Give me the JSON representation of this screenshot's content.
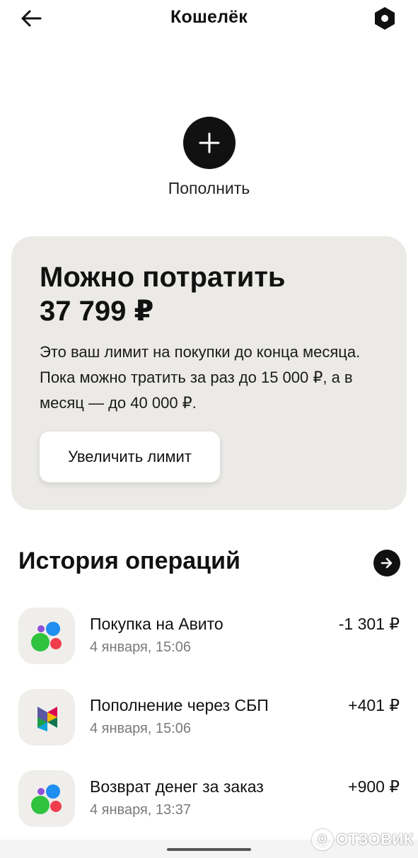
{
  "header": {
    "title": "Кошелёк"
  },
  "topup": {
    "label": "Пополнить"
  },
  "limit_card": {
    "title": "Можно потратить",
    "amount": "37 799 ₽",
    "description": "Это ваш лимит на покупки до конца месяца. Пока можно тратить за раз до 15 000 ₽, а в месяц — до 40 000 ₽.",
    "button_label": "Увеличить лимит"
  },
  "history": {
    "title": "История операций",
    "items": [
      {
        "name": "Покупка на Авито",
        "date": "4 января, 15:06",
        "amount": "-1 301 ₽",
        "icon": "avito-logo-icon"
      },
      {
        "name": "Пополнение через СБП",
        "date": "4 января, 15:06",
        "amount": "+401 ₽",
        "icon": "sbp-logo-icon"
      },
      {
        "name": "Возврат денег за заказ",
        "date": "4 января, 13:37",
        "amount": "+900 ₽",
        "icon": "avito-logo-icon"
      }
    ]
  },
  "watermark": {
    "text": "ОТЗОВИК",
    "symbol": "О"
  },
  "colors": {
    "card_bg": "#ebeae7",
    "avito_green": "#2fc33e",
    "avito_blue": "#1f8ef1",
    "avito_red": "#f03d4e",
    "avito_purple": "#8f4fd8"
  }
}
